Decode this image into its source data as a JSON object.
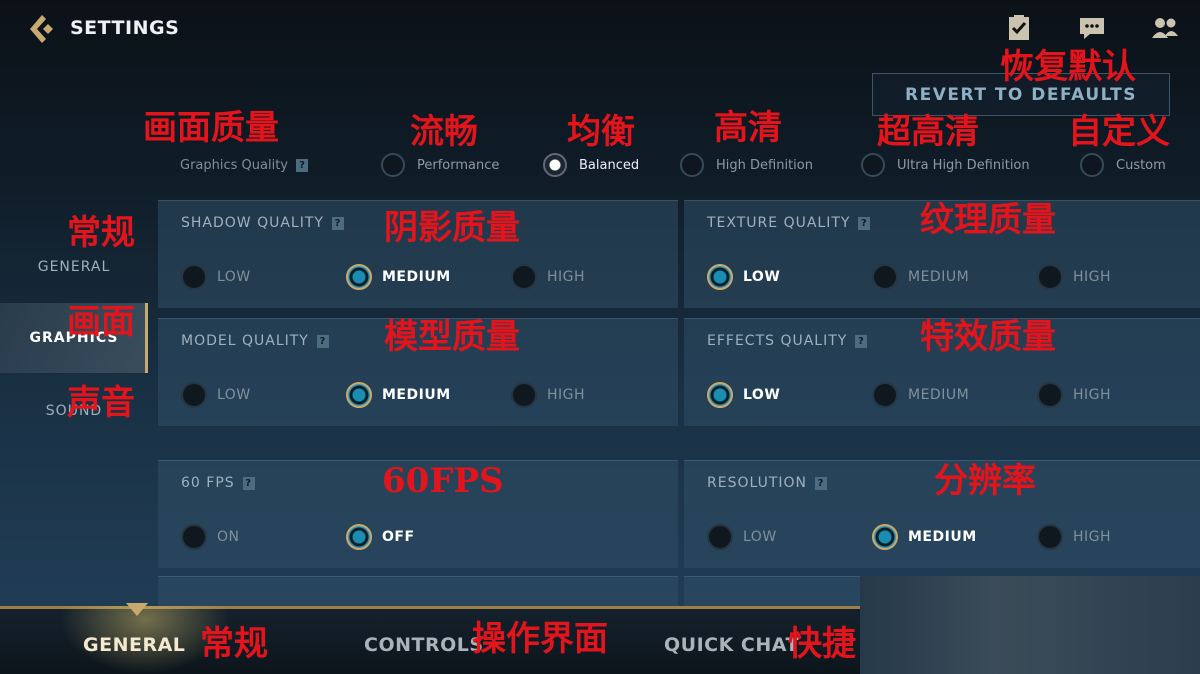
{
  "header": {
    "title": "SETTINGS",
    "revert_label": "REVERT TO DEFAULTS",
    "icons": [
      "mission-checklist-icon",
      "chat-icon",
      "friends-icon"
    ]
  },
  "graphics_quality": {
    "label": "Graphics Quality",
    "help": "?",
    "options": [
      "Performance",
      "Balanced",
      "High Definition",
      "Ultra High Definition",
      "Custom"
    ],
    "selected": "Balanced"
  },
  "sidebar": {
    "items": [
      {
        "label": "GENERAL"
      },
      {
        "label": "GRAPHICS",
        "selected": true
      },
      {
        "label": "SOUND"
      }
    ]
  },
  "panels": [
    {
      "title": "SHADOW QUALITY",
      "options": [
        "LOW",
        "MEDIUM",
        "HIGH"
      ],
      "selected": "MEDIUM"
    },
    {
      "title": "TEXTURE QUALITY",
      "options": [
        "LOW",
        "MEDIUM",
        "HIGH"
      ],
      "selected": "LOW"
    },
    {
      "title": "MODEL QUALITY",
      "options": [
        "LOW",
        "MEDIUM",
        "HIGH"
      ],
      "selected": "MEDIUM"
    },
    {
      "title": "EFFECTS QUALITY",
      "options": [
        "LOW",
        "MEDIUM",
        "HIGH"
      ],
      "selected": "LOW"
    },
    {
      "title": "60 FPS",
      "options": [
        "ON",
        "OFF"
      ],
      "selected": "OFF"
    },
    {
      "title": "RESOLUTION",
      "options": [
        "LOW",
        "MEDIUM",
        "HIGH"
      ],
      "selected": "MEDIUM"
    }
  ],
  "bottom_tabs": [
    {
      "label": "GENERAL",
      "selected": true
    },
    {
      "label": "CONTROLS"
    },
    {
      "label": "QUICK CHAT"
    }
  ],
  "annotations": {
    "revert": "恢复默认",
    "gq": "画面质量",
    "perf": "流畅",
    "bal": "均衡",
    "hd": "高清",
    "uhd": "超高清",
    "custom": "自定义",
    "general": "常规",
    "graphics": "画面",
    "sound": "声音",
    "shadow": "阴影质量",
    "texture": "纹理质量",
    "model": "模型质量",
    "effects": "特效质量",
    "fps": "60FPS",
    "res": "分辨率",
    "tab_general": "常规",
    "tab_controls": "操作界面",
    "tab_quick": "快捷"
  },
  "colors": {
    "accent_gold": "#c8aa6e",
    "selected_radio": "#1b8db3",
    "annotation_red": "#e3141b"
  }
}
